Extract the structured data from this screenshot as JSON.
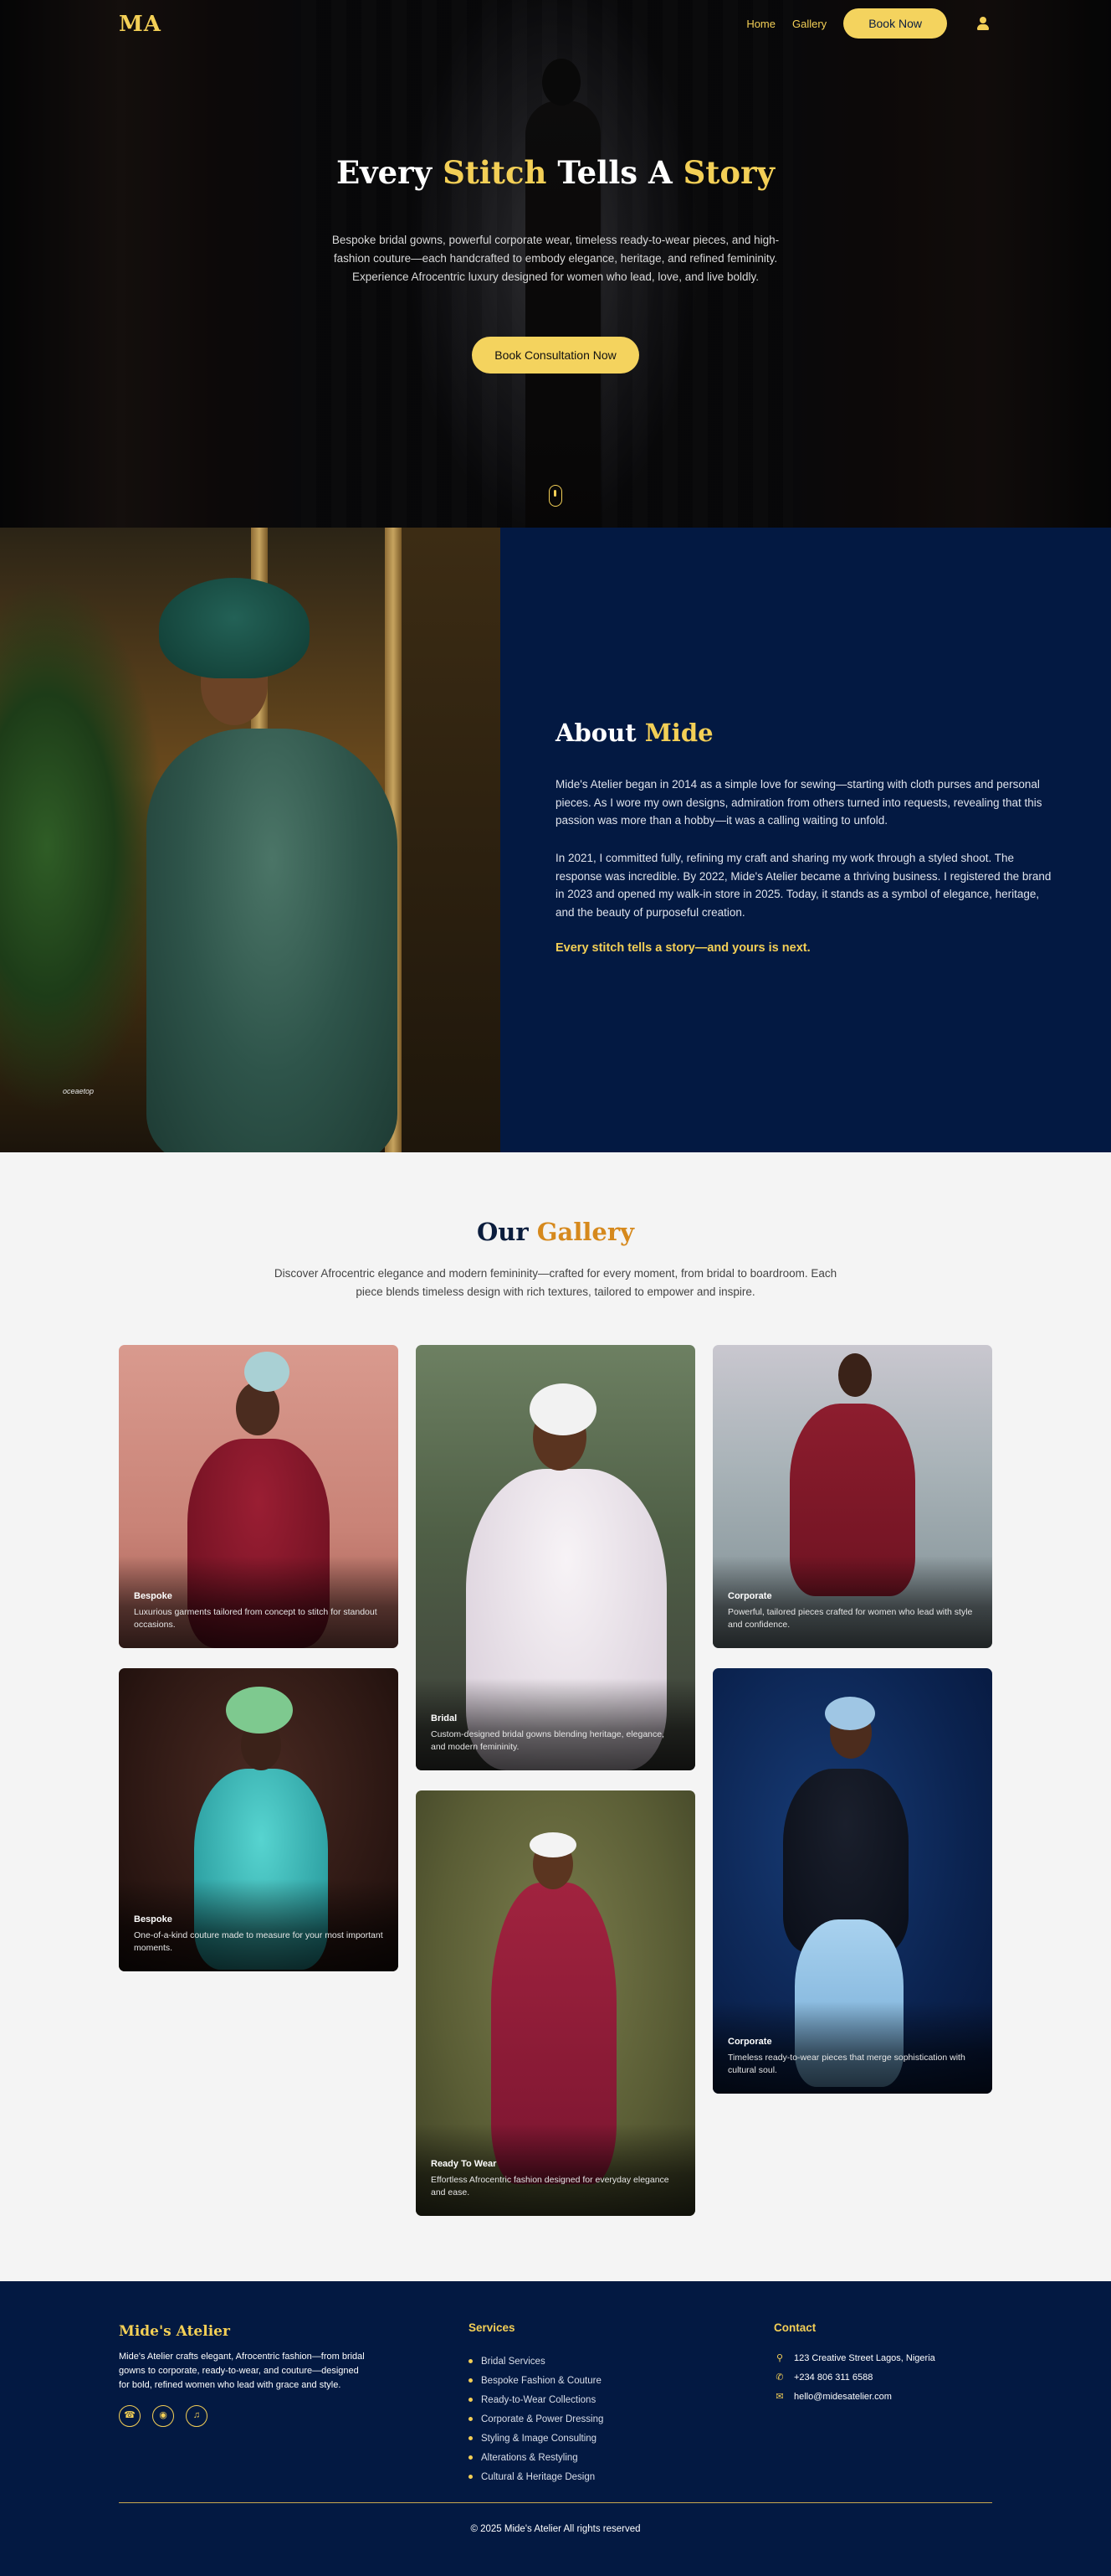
{
  "nav": {
    "logo": "MA",
    "links": [
      "Home",
      "Gallery"
    ],
    "book_label": "Book Now"
  },
  "hero": {
    "title_parts": [
      "Every ",
      "Stitch",
      " Tells A ",
      "Story"
    ],
    "subtitle": "Bespoke bridal gowns, powerful corporate wear, timeless ready-to-wear pieces, and high-fashion couture—each handcrafted to embody elegance, heritage, and refined femininity. Experience Afrocentric luxury designed for women who lead, love, and live boldly.",
    "cta": "Book Consultation Now"
  },
  "about": {
    "title_plain": "About ",
    "title_gold": "Mide",
    "photo_caption": "oceaetop",
    "p1": "Mide's Atelier began in 2014 as a simple love for sewing—starting with cloth purses and personal pieces. As I wore my own designs, admiration from others turned into requests, revealing that this passion was more than a hobby—it was a calling waiting to unfold.",
    "p2": "In 2021, I committed fully, refining my craft and sharing my work through a styled shoot. The response was incredible. By 2022, Mide's Atelier became a thriving business. I registered the brand in 2023 and opened my walk-in store in 2025. Today, it stands as a symbol of elegance, heritage, and the beauty of purposeful creation.",
    "tagline": "Every stitch tells a story—and yours is next."
  },
  "gallery": {
    "title_plain": "Our ",
    "title_gold": "Gallery",
    "subtitle": "Discover Afrocentric elegance and modern femininity—crafted for every moment, from bridal to boardroom. Each piece blends timeless design with rich textures, tailored to empower and inspire.",
    "cards": [
      {
        "category": "Bespoke",
        "desc": "Luxurious garments tailored from concept to stitch for standout occasions."
      },
      {
        "category": "Bespoke",
        "desc": "One-of-a-kind couture made to measure for your most important moments."
      },
      {
        "category": "Bridal",
        "desc": "Custom-designed bridal gowns blending heritage, elegance, and modern femininity."
      },
      {
        "category": "Ready To Wear",
        "desc": "Effortless Afrocentric fashion designed for everyday elegance and ease."
      },
      {
        "category": "Corporate",
        "desc": "Powerful, tailored pieces crafted for women who lead with style and confidence."
      },
      {
        "category": "Corporate",
        "desc": "Timeless ready-to-wear pieces that merge sophistication with cultural soul."
      }
    ]
  },
  "footer": {
    "brand": "Mide's Atelier",
    "about": "Mide's Atelier crafts elegant, Afrocentric fashion—from bridal gowns to corporate, ready-to-wear, and couture—designed for bold, refined women who lead with grace and style.",
    "services_heading": "Services",
    "services": [
      "Bridal Services",
      "Bespoke Fashion & Couture",
      "Ready-to-Wear Collections",
      "Corporate & Power Dressing",
      "Styling & Image Consulting",
      "Alterations & Restyling",
      "Cultural & Heritage Design"
    ],
    "contact_heading": "Contact",
    "address": "123 Creative Street Lagos, Nigeria",
    "phone": "+234 806 311 6588",
    "email": "hello@midesatelier.com",
    "copyright": "© 2025 Mide's Atelier All rights reserved"
  },
  "colors": {
    "gold": "#f3cf56",
    "navy": "#031942",
    "orange": "#d6891d"
  },
  "icons": [
    "user-icon",
    "whatsapp-icon",
    "instagram-icon",
    "tiktok-icon",
    "location-icon",
    "phone-icon",
    "mail-icon",
    "scroll-indicator-icon"
  ]
}
